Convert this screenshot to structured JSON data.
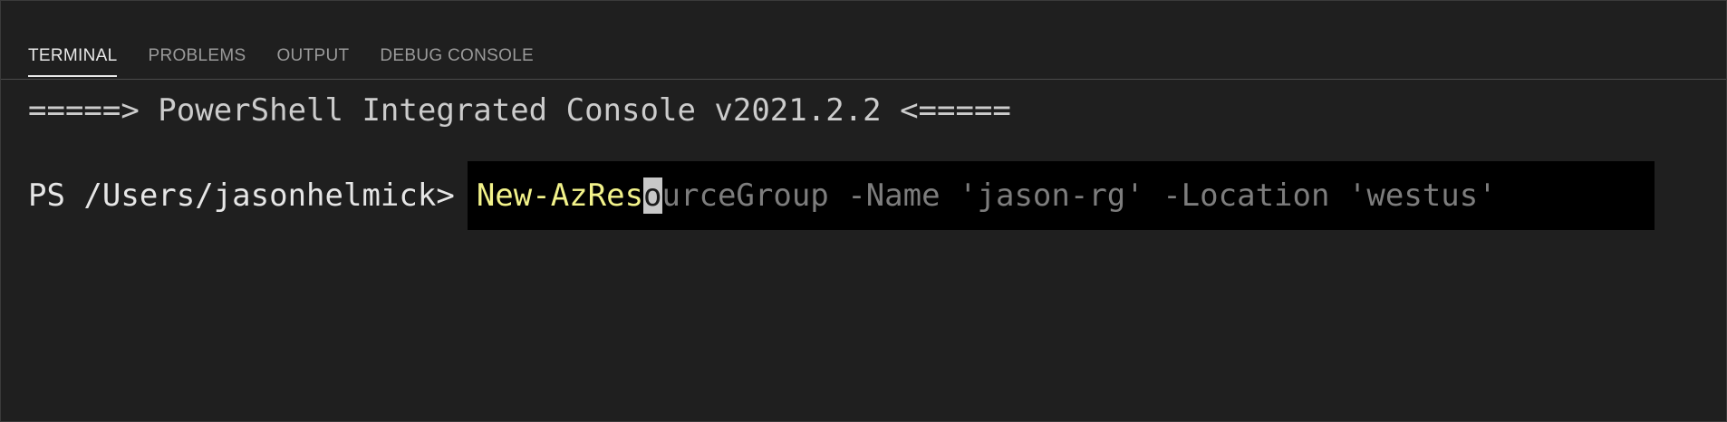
{
  "panel": {
    "tabs": [
      {
        "label": "TERMINAL",
        "active": true
      },
      {
        "label": "PROBLEMS",
        "active": false
      },
      {
        "label": "OUTPUT",
        "active": false
      },
      {
        "label": "DEBUG CONSOLE",
        "active": false
      }
    ]
  },
  "terminal": {
    "banner": "=====> PowerShell Integrated Console v2021.2.2 <=====",
    "prompt": "PS /Users/jasonhelmick>",
    "input": {
      "typed": "New-AzRes",
      "cursor_char": "o",
      "suggestion": "urceGroup -Name 'jason-rg' -Location 'westus'"
    }
  },
  "colors": {
    "background": "#1f1f1f",
    "typed_text": "#f2f28a",
    "suggestion_text": "#7d7d7d",
    "input_background": "#000000"
  }
}
